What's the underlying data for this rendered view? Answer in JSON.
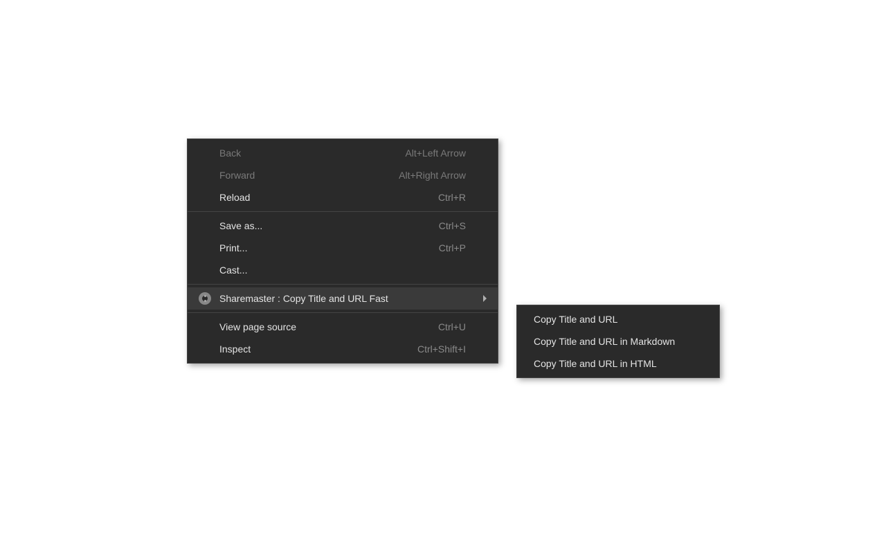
{
  "contextMenu": {
    "back": {
      "label": "Back",
      "shortcut": "Alt+Left Arrow"
    },
    "forward": {
      "label": "Forward",
      "shortcut": "Alt+Right Arrow"
    },
    "reload": {
      "label": "Reload",
      "shortcut": "Ctrl+R"
    },
    "saveAs": {
      "label": "Save as...",
      "shortcut": "Ctrl+S"
    },
    "print": {
      "label": "Print...",
      "shortcut": "Ctrl+P"
    },
    "cast": {
      "label": "Cast..."
    },
    "sharemaster": {
      "label": "Sharemaster : Copy Title and URL Fast"
    },
    "viewSource": {
      "label": "View page source",
      "shortcut": "Ctrl+U"
    },
    "inspect": {
      "label": "Inspect",
      "shortcut": "Ctrl+Shift+I"
    }
  },
  "submenu": {
    "copyTitleUrl": {
      "label": "Copy Title and URL"
    },
    "copyTitleUrlMd": {
      "label": "Copy Title and URL in Markdown"
    },
    "copyTitleUrlHtml": {
      "label": "Copy Title and URL in HTML"
    }
  }
}
